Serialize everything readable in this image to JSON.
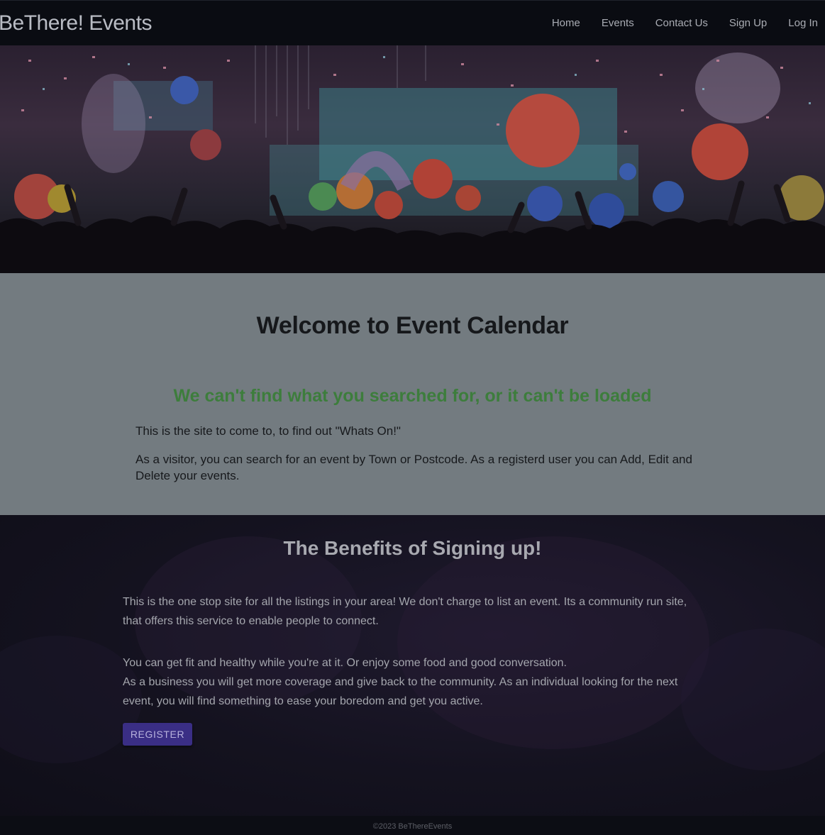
{
  "navbar": {
    "brand": "BeThere! Events",
    "links": [
      "Home",
      "Events",
      "Contact Us",
      "Sign Up",
      "Log In"
    ]
  },
  "welcome": {
    "title": "Welcome to Event Calendar",
    "error": "We can't find what you searched for, or it can't be loaded",
    "p1": "This is the site to come to, to find out \"Whats On!\"",
    "p2": "As a visitor, you can search for an event by Town or Postcode. As a registerd user you can Add, Edit and Delete your events."
  },
  "benefits": {
    "title": "The Benefits of Signing up!",
    "p1": "This is the one stop site for all the listings in your area! We don't charge to list an event. Its a community run site, that offers this service to enable people to connect.",
    "p2_line1": "You can get fit and healthy while you're at it. Or enjoy some food and good conversation.",
    "p2_line2": "As a business you will get more coverage and give back to the community. As an individual looking for the next event, you will find something to ease your boredom and get you active.",
    "register_label": "REGISTER"
  },
  "footer": {
    "copyright": "©2023 BeThereEvents"
  },
  "colors": {
    "welcome_bg": "#737b80",
    "error_green": "#3d7d3c",
    "register_btn": "#3a2e85"
  }
}
